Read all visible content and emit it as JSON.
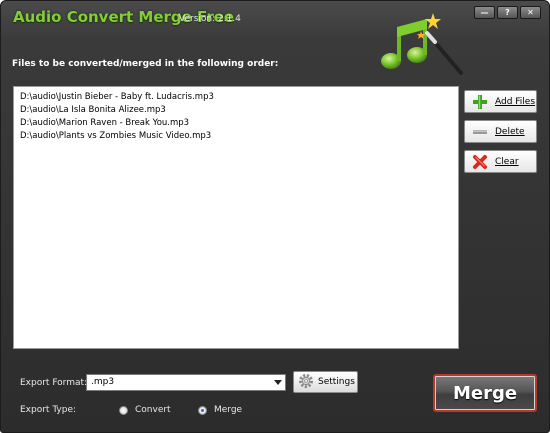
{
  "window": {
    "app_title": "Audio Convert Merge Free",
    "version": "Version: 2.1.4",
    "buttons": {
      "minimize": "—",
      "help": "?",
      "close": "✕"
    }
  },
  "main": {
    "files_label": "Files to be converted/merged in the following order:",
    "files": [
      "D:\\audio\\Justin Bieber - Baby ft. Ludacris.mp3",
      "D:\\audio\\La Isla Bonita Alizee.mp3",
      "D:\\audio\\Marion Raven - Break You.mp3",
      "D:\\audio\\Plants vs Zombies Music Video.mp3"
    ]
  },
  "side_buttons": {
    "add": "Add Files",
    "delete": "Delete",
    "clear": "Clear"
  },
  "export": {
    "format_label": "Export Format:",
    "format_value": ".mp3",
    "settings_label": "Settings",
    "type_label": "Export Type:",
    "type_options": [
      "Convert",
      "Merge"
    ],
    "selected_type": "Merge"
  },
  "merge_button": "Merge",
  "colors": {
    "title_green": "#86cc3a",
    "window_dark": "#2c2c2c",
    "merge_border": "#b53a2a"
  },
  "icons": {
    "logo": "music-note-magic-wand-icon",
    "add": "plus-icon",
    "delete": "minus-icon",
    "clear": "red-x-icon",
    "settings": "gear-icon"
  }
}
